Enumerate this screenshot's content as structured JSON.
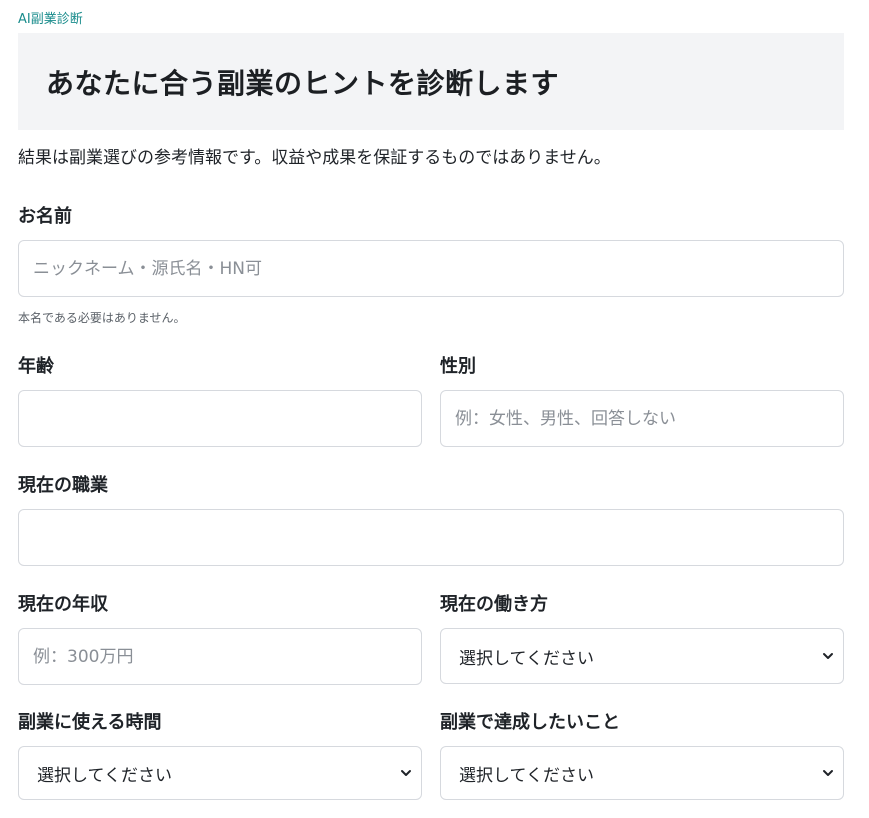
{
  "brand": "AI副業診断",
  "hero": {
    "title": "あなたに合う副業のヒントを診断します"
  },
  "intro": "結果は副業選びの参考情報です。収益や成果を保証するものではありません。",
  "fields": {
    "name": {
      "label": "お名前",
      "placeholder": "ニックネーム・源氏名・HN可",
      "hint": "本名である必要はありません。"
    },
    "age": {
      "label": "年齢",
      "placeholder": ""
    },
    "gender": {
      "label": "性別",
      "placeholder": "例：女性、男性、回答しない"
    },
    "job": {
      "label": "現在の職業",
      "placeholder": ""
    },
    "income": {
      "label": "現在の年収",
      "placeholder": "例：300万円"
    },
    "workstyle": {
      "label": "現在の働き方",
      "value": "選択してください"
    },
    "time": {
      "label": "副業に使える時間",
      "value": "選択してください"
    },
    "goal": {
      "label": "副業で達成したいこと",
      "value": "選択してください"
    }
  },
  "icons": {
    "select_arrow": "chevron-down-icon"
  }
}
